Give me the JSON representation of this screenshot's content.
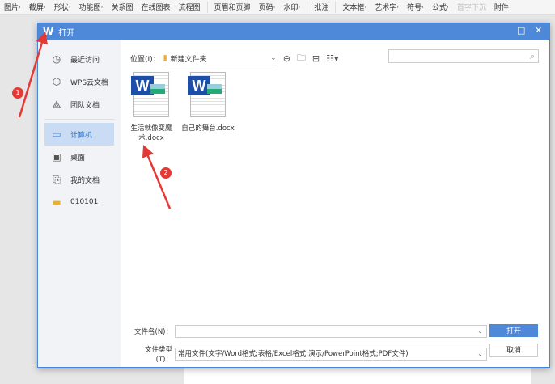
{
  "toolbar": {
    "items": [
      "图片·",
      "截屏·",
      "形状·",
      "功能图·",
      "关系图",
      "在线图表",
      "流程图",
      "页眉和页脚",
      "页码·",
      "水印·",
      "批注",
      "文本框·",
      "艺术字·",
      "符号·",
      "公式·",
      "首字下沉",
      "附件"
    ]
  },
  "dialog": {
    "title": "打开",
    "logo": "W",
    "maximize": "□",
    "close": "✕"
  },
  "sidebar": {
    "items": [
      {
        "label": "最近访问",
        "icon": "clock-icon"
      },
      {
        "label": "WPS云文档",
        "icon": "cube-icon"
      },
      {
        "label": "团队文档",
        "icon": "team-icon"
      },
      {
        "label": "计算机",
        "icon": "computer-icon"
      },
      {
        "label": "桌面",
        "icon": "desktop-icon"
      },
      {
        "label": "我的文档",
        "icon": "my-docs-icon"
      },
      {
        "label": "010101",
        "icon": "folder-icon"
      }
    ]
  },
  "location": {
    "label": "位置(I)：",
    "value": "新建文件夹"
  },
  "files": [
    {
      "name": "生活就像变魔术.docx"
    },
    {
      "name": "自己的舞台.docx"
    }
  ],
  "bottom": {
    "filename_label": "文件名(N)：",
    "filename_value": "",
    "filetype_label": "文件类型(T)：",
    "filetype_value": "常用文件(文字/Word格式;表格/Excel格式;演示/PowerPoint格式;PDF文件)",
    "open": "打开",
    "cancel": "取消"
  },
  "annotations": {
    "badge1": "1",
    "badge2": "2"
  },
  "colors": {
    "accent": "#4d88d9",
    "annotation": "#e53935"
  }
}
